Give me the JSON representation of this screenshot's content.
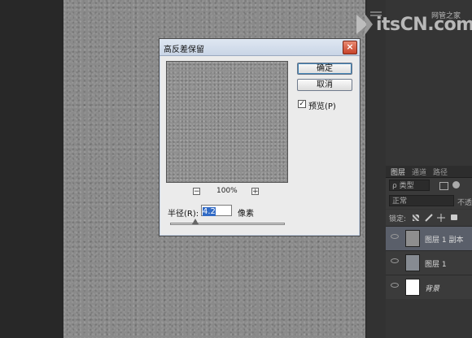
{
  "dialog": {
    "title": "高反差保留",
    "close_glyph": "×",
    "ok_label": "确定",
    "cancel_label": "取消",
    "preview_label": "预览(P)",
    "preview_checked": true,
    "zoom_minus": "−",
    "zoom_plus": "+",
    "zoom_level": "100%",
    "radius_label": "半径(R):",
    "radius_value": "4.2",
    "radius_unit": "像素",
    "radius_slider_fraction": 0.22
  },
  "watermark": {
    "text": "itsCN.com",
    "sub_line1": "网管之家",
    "sub_line2": ""
  },
  "layers_panel": {
    "tabs": [
      "图层",
      "通道",
      "路径"
    ],
    "filter_kind": "ρ 类型",
    "blend_mode": "正常",
    "opacity_label": "不透",
    "lock_label": "锁定:",
    "layers": [
      {
        "name": "图层 1 副本",
        "selected": true,
        "thumb": "gray"
      },
      {
        "name": "图层 1",
        "selected": false,
        "thumb": "gray"
      },
      {
        "name": "背景",
        "selected": false,
        "thumb": "white"
      }
    ]
  },
  "colors": {
    "canvas": "#8a8a8a",
    "dialog_bg": "#ebebeb",
    "close_red": "#c7432a",
    "selection_blue": "#316ac5"
  }
}
